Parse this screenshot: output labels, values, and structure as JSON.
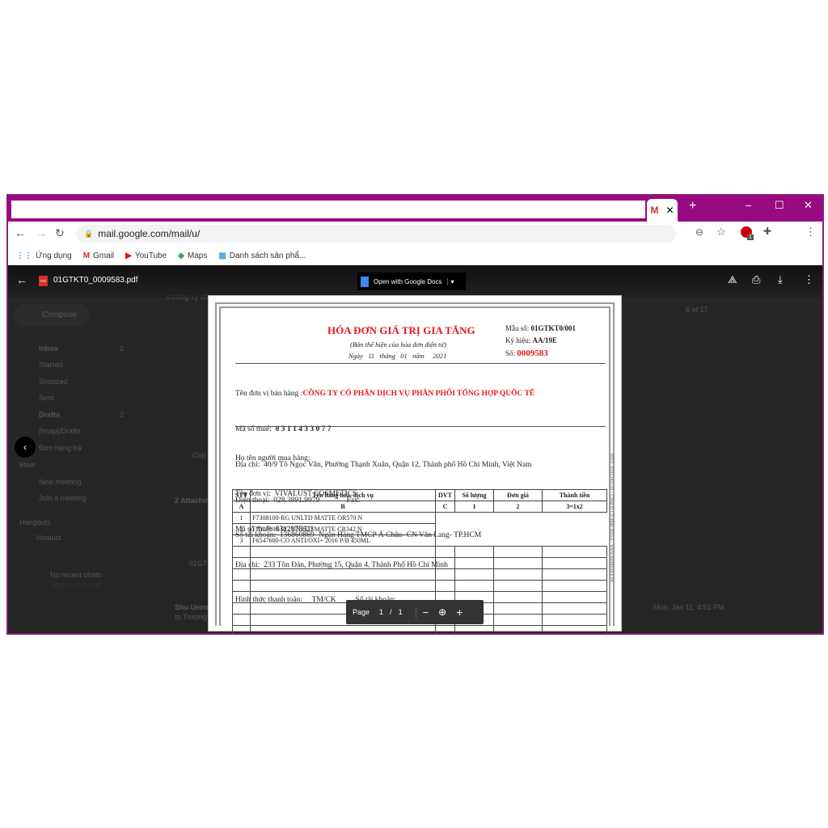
{
  "browser": {
    "tab_icon": "gmail-icon",
    "url": "mail.google.com/mail/u/",
    "bookmarks": [
      {
        "label": "Ứng dụng",
        "icon": "apps-grid-icon"
      },
      {
        "label": "Gmail",
        "icon": "gmail-icon"
      },
      {
        "label": "YouTube",
        "icon": "youtube-icon"
      },
      {
        "label": "Maps",
        "icon": "maps-icon"
      },
      {
        "label": "Danh sách sản phẩ...",
        "icon": "sheets-icon"
      }
    ],
    "extension_badge": "1",
    "title_color": "#990a80"
  },
  "pdf_viewer": {
    "filename": "01GTKT0_0009583.pdf",
    "open_with": "Open with Google Docs",
    "page_label": "Page",
    "page_current": "1",
    "page_sep": "/",
    "page_total": "1"
  },
  "gmail_bg": {
    "compose": "Compose",
    "search": "trương vỵ võ",
    "nav": [
      {
        "label": "Inbox",
        "count": "2"
      },
      {
        "label": "Starred"
      },
      {
        "label": "Snoozed"
      },
      {
        "label": "Sent"
      },
      {
        "label": "Drafts",
        "count": "2"
      },
      {
        "label": "[Imap]/Drafts"
      },
      {
        "label": "Đơn hàng trả"
      }
    ],
    "meet_title": "Meet",
    "meet": [
      "New meeting",
      "Join a meeting"
    ],
    "hangouts_title": "Hangouts",
    "hangouts_user": "Vivalust",
    "no_chats": "No recent chats",
    "start_new": "Start a new one",
    "pager": "6 of 17",
    "attachments": "2 Attachm",
    "sender": "Shu Uemu",
    "sender_to": "to Trương",
    "date": "Mon, Jan 11, 4:51 PM",
    "copy": "Cop",
    "attach_file": "01GT"
  },
  "invoice": {
    "title": "HÓA ĐƠN GIÁ TRỊ GIA TĂNG",
    "subtitle": "(Bản thể hiện của hóa đơn điện tử)",
    "date": "Ngày   11   tháng   01   năm     2021",
    "form_label": "Mẫu số:",
    "form_value": "01GTKT0/001",
    "symbol_label": "Ký hiệu:",
    "symbol_value": "AA/19E",
    "no_label": "Số:",
    "no_value": "0009583",
    "seller_label": "Tên đơn vị bán hàng :",
    "seller_name": "CÔNG TY CỔ PHẦN DỊCH VỤ PHÂN PHỐI TỔNG HỢP QUỐC TẾ",
    "seller_tax_label": "Mã số thuế:",
    "seller_tax": "0 3 1 1 4 3 3 0 7 7",
    "seller_address": "Địa chỉ:  40/9 Tô Ngọc Vân, Phường Thạnh Xuân, Quận 12, Thành phố Hồ Chí Minh, Việt Nam",
    "seller_phone": "Điện thoại:  028.3891.9979",
    "fax": "Fax:",
    "seller_account": "Số tài khoản:  136860869- Ngân Hàng TMCP Á Châu- CN Văn Lang- TP.HCM",
    "buyer_name": "Họ tên người mua hàng:",
    "buyer_unit": "Tên đơn vị:  VIVALUST COSMETICS",
    "buyer_tax": "Mã số thuế:  8312975623",
    "buyer_address": "Địa chỉ:  233 Tôn Đản, Phường 15, Quận 4, Thành Phố Hồ Chí Minh",
    "payment": "Hình thức thanh toán:     TM/CK",
    "buyer_account": "Số tài khoản:",
    "headers": [
      "STT",
      "Tên hàng hóa, dịch vụ",
      "DVT",
      "Số lượng",
      "Đơn giá",
      "Thành tiền"
    ],
    "codes": [
      "A",
      "B",
      "C",
      "1",
      "2",
      "3=1x2"
    ],
    "rows": [
      [
        "1",
        "F7308100-RG UNLTD MATTE OR570 N"
      ],
      [
        "2",
        "F7307800-RG UNLTD MATTE CR342 N"
      ],
      [
        "3",
        "F6547600-CO ANTI/OXI+ 2016 P/B 450ML"
      ]
    ],
    "side_text": "MST: 0101243150 - Công ty Cổ phần MISA - www.meinvoice.vn"
  }
}
